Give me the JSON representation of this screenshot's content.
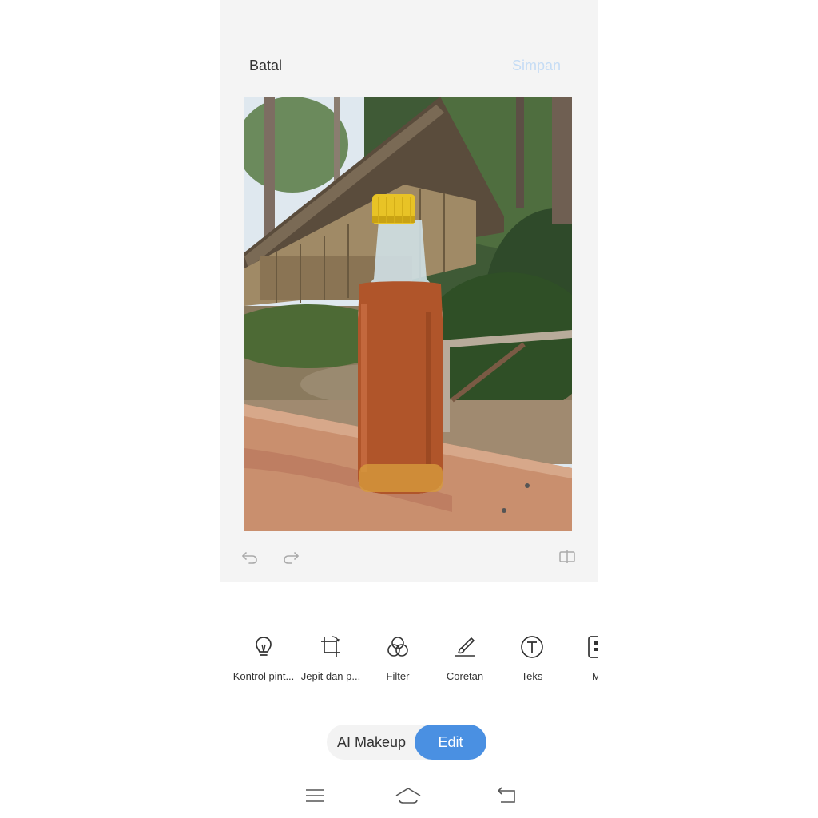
{
  "header": {
    "cancel_label": "Batal",
    "save_label": "Simpan"
  },
  "tools": [
    {
      "label": "Kontrol pint...",
      "icon": "lightbulb-icon"
    },
    {
      "label": "Jepit dan p...",
      "icon": "crop-rotate-icon"
    },
    {
      "label": "Filter",
      "icon": "filter-circles-icon"
    },
    {
      "label": "Coretan",
      "icon": "brush-icon"
    },
    {
      "label": "Teks",
      "icon": "text-icon"
    },
    {
      "label": "Mo",
      "icon": "mosaic-icon"
    }
  ],
  "modes": {
    "makeup_label": "AI Makeup",
    "edit_label": "Edit"
  },
  "colors": {
    "accent": "#4a90e2",
    "save_disabled": "#c5dcf5",
    "editor_bg": "#f4f4f4"
  },
  "icons": {
    "undo": "undo-icon",
    "redo": "redo-icon",
    "compare": "compare-icon",
    "menu": "menu-icon",
    "home": "home-icon",
    "back": "back-icon"
  }
}
